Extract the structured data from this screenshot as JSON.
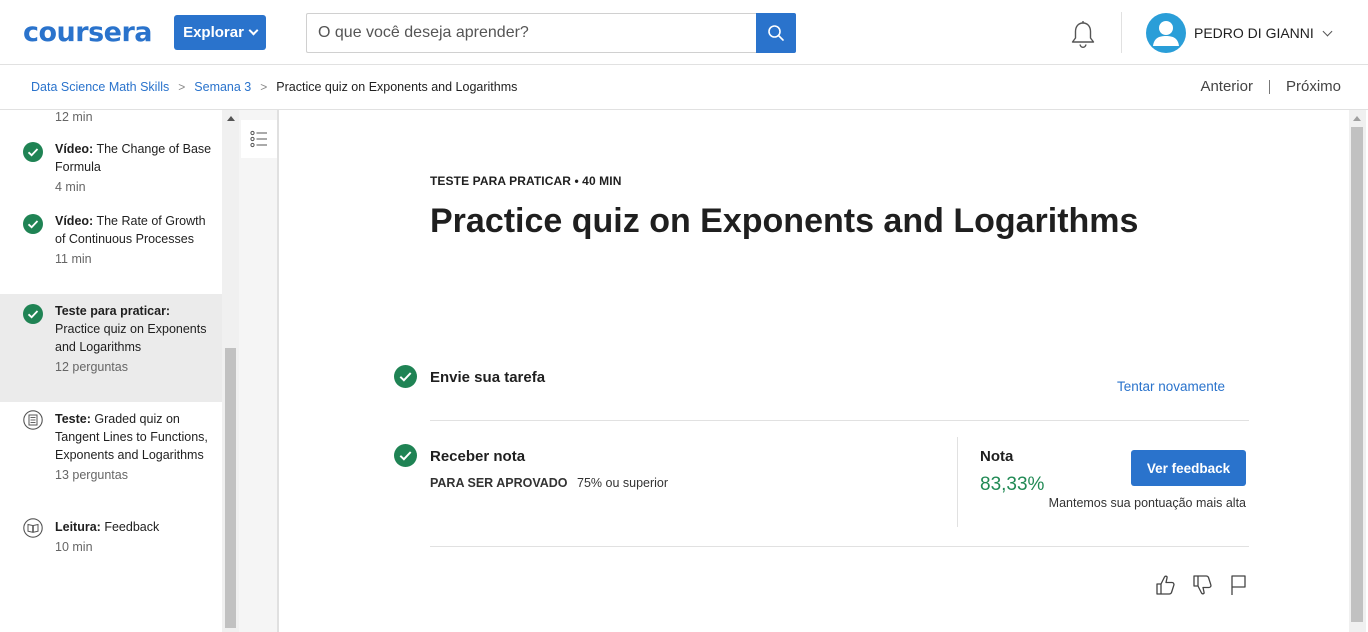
{
  "header": {
    "logo": "coursera",
    "explore_label": "Explorar",
    "search_placeholder": "O que você deseja aprender?",
    "user_name": "PEDRO DI GIANNI"
  },
  "breadcrumb": {
    "items": [
      "Data Science Math Skills",
      "Semana 3",
      "Practice quiz on Exponents and Logarithms"
    ],
    "prev_label": "Anterior",
    "next_label": "Próximo"
  },
  "sidebar": {
    "items": [
      {
        "meta": "12 min"
      },
      {
        "type": "Vídeo:",
        "title": "The Change of Base Formula",
        "meta": "4 min",
        "icon": "check-circle-icon"
      },
      {
        "type": "Vídeo:",
        "title": "The Rate of Growth of Continuous Processes",
        "meta": "11 min",
        "icon": "check-circle-icon"
      },
      {
        "type": "Teste para praticar:",
        "title": "Practice quiz on Exponents and Logarithms",
        "meta": "12 perguntas",
        "icon": "check-circle-icon",
        "active": true
      },
      {
        "type": "Teste:",
        "title": "Graded quiz on Tangent Lines to Functions, Exponents and Logarithms",
        "meta": "13 perguntas",
        "icon": "quiz-icon"
      },
      {
        "type": "Leitura:",
        "title": "Feedback",
        "meta": "10 min",
        "icon": "book-icon"
      }
    ]
  },
  "main": {
    "kicker": "TESTE PARA PRATICAR • 40 MIN",
    "title": "Practice quiz on Exponents and Logarithms",
    "submit_label": "Envie sua tarefa",
    "retry_label": "Tentar novamente",
    "grade_row_label": "Receber nota",
    "pass_label": "PARA SER APROVADO",
    "pass_value": "75% ou superior",
    "grade_label": "Nota",
    "grade_value": "83,33%",
    "feedback_button": "Ver feedback",
    "grade_note": "Mantemos sua pontuação mais alta"
  },
  "colors": {
    "brand": "#2a73cc",
    "success": "#1f8354",
    "grade": "#218a55"
  }
}
